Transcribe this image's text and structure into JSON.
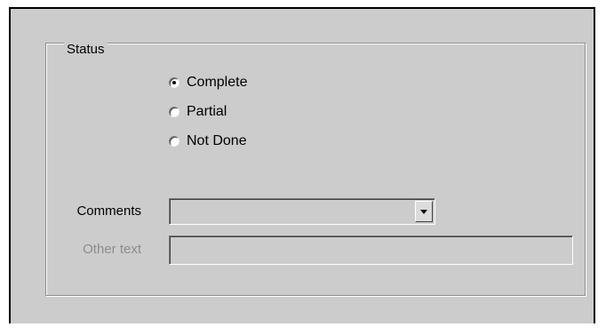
{
  "status_group": {
    "title": "Status",
    "options": [
      {
        "label": "Complete",
        "checked": true
      },
      {
        "label": "Partial",
        "checked": false
      },
      {
        "label": "Not Done",
        "checked": false
      }
    ]
  },
  "comments": {
    "label": "Comments",
    "value": ""
  },
  "other_text": {
    "label": "Other text",
    "value": "",
    "disabled": true
  },
  "colors": {
    "panel_background": "#cccccc",
    "disabled_text": "#8c8c8c"
  }
}
